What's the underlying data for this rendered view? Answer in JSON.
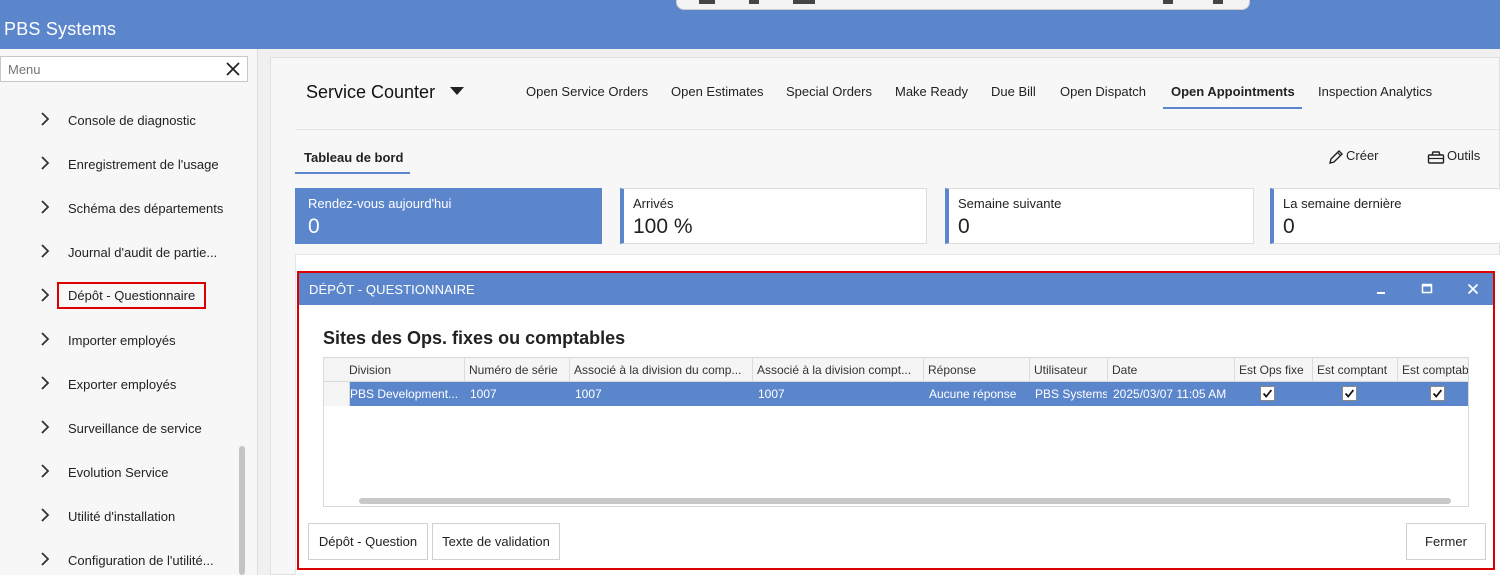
{
  "app": {
    "title": "PBS Systems"
  },
  "sidebar": {
    "search_placeholder": "Menu",
    "items": [
      {
        "label": "Console de diagnostic"
      },
      {
        "label": "Enregistrement de l'usage"
      },
      {
        "label": "Schéma des départements"
      },
      {
        "label": "Journal d'audit de partie..."
      },
      {
        "label": "Dépôt - Questionnaire"
      },
      {
        "label": "Importer employés"
      },
      {
        "label": "Exporter employés"
      },
      {
        "label": "Surveillance de service"
      },
      {
        "label": "Evolution Service"
      },
      {
        "label": "Utilité d'installation"
      },
      {
        "label": "Configuration de l'utilité..."
      }
    ]
  },
  "main": {
    "title": "Service Counter",
    "tabs": [
      {
        "label": "Open Service Orders"
      },
      {
        "label": "Open Estimates"
      },
      {
        "label": "Special Orders"
      },
      {
        "label": "Make Ready"
      },
      {
        "label": "Due Bill"
      },
      {
        "label": "Open Dispatch"
      },
      {
        "label": "Open Appointments"
      },
      {
        "label": "Inspection Analytics"
      }
    ],
    "dashboard_tab": "Tableau de bord",
    "create_label": "Créer",
    "tools_label": "Outils",
    "kpis": [
      {
        "label": "Rendez-vous aujourd'hui",
        "value": "0"
      },
      {
        "label": "Arrivés",
        "value": "100 %"
      },
      {
        "label": "Semaine suivante",
        "value": "0"
      },
      {
        "label": "La semaine dernière",
        "value": "0"
      }
    ]
  },
  "modal": {
    "title": "DÉPÔT - QUESTIONNAIRE",
    "subtitle": "Sites des Ops. fixes ou comptables",
    "columns": [
      "Division",
      "Numéro de série",
      "Associé à la division du comp...",
      "Associé à la division compt...",
      "Réponse",
      "Utilisateur",
      "Date",
      "Est Ops fixe",
      "Est comptant",
      "Est comptabl"
    ],
    "rows": [
      {
        "division": "PBS Development...",
        "serial": "1007",
        "assoc1": "1007",
        "assoc2": "1007",
        "response": "Aucune réponse",
        "user": "PBS Systems",
        "date": "2025/03/07 11:05 AM"
      }
    ],
    "buttons": {
      "question": "Dépôt - Question",
      "validation": "Texte de validation",
      "close": "Fermer"
    }
  },
  "colors": {
    "accent": "#5b86cc",
    "highlight": "#dd0000"
  }
}
